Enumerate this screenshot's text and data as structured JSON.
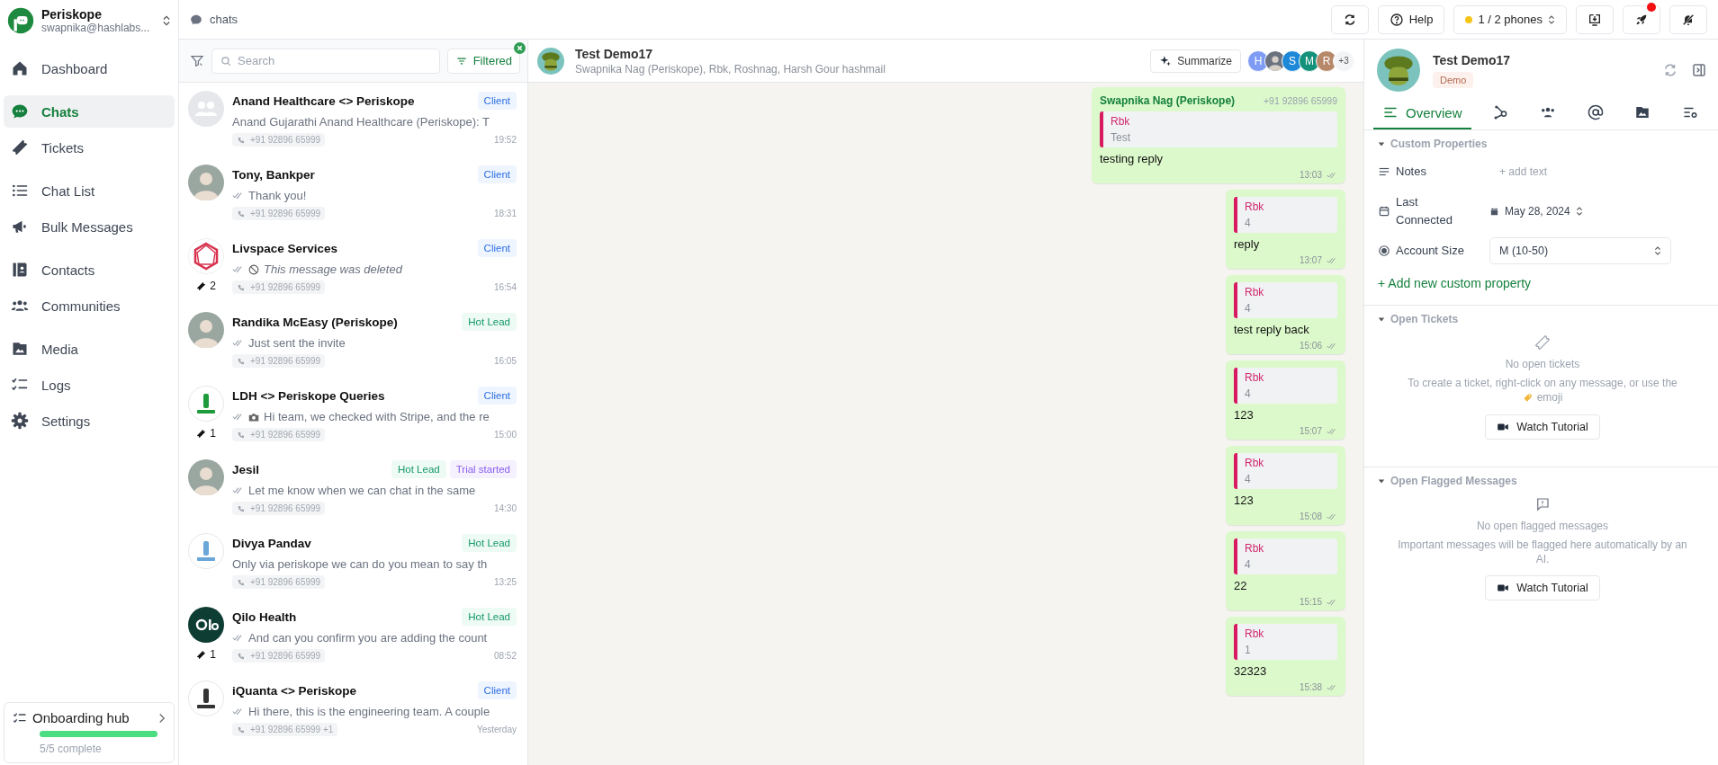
{
  "sidebar": {
    "workspace": {
      "name": "Periskope",
      "email": "swapnika@hashlabs..."
    },
    "nav_groups": [
      {
        "items": [
          {
            "label": "Dashboard",
            "selected": false
          }
        ]
      },
      {
        "items": [
          {
            "label": "Chats",
            "selected": true
          },
          {
            "label": "Tickets",
            "selected": false
          }
        ]
      },
      {
        "items": [
          {
            "label": "Chat List",
            "selected": false
          },
          {
            "label": "Bulk Messages",
            "selected": false
          }
        ]
      },
      {
        "items": [
          {
            "label": "Contacts",
            "selected": false
          },
          {
            "label": "Communities",
            "selected": false
          }
        ]
      },
      {
        "items": [
          {
            "label": "Media",
            "selected": false
          },
          {
            "label": "Logs",
            "selected": false
          },
          {
            "label": "Settings",
            "selected": false
          }
        ]
      }
    ],
    "onboarding": {
      "title": "Onboarding hub",
      "level": 1,
      "progress": "5/5 complete"
    }
  },
  "topbar": {
    "section": "chats",
    "help": "Help",
    "phones": "1 / 2 phones",
    "notification_dot": true
  },
  "chat_list": {
    "search": {
      "placeholder": "Search"
    },
    "filter": {
      "label": "Filtered",
      "active": true
    },
    "chats": [
      {
        "name": "Anand Healthcare <> Periskope",
        "avatar": {
          "kind": "group"
        },
        "tags": [
          {
            "label": "Client",
            "kind": "client"
          }
        ],
        "ticks": false,
        "preview": {
          "kind": "text",
          "text": "Anand Gujarathi Anand Healthcare (Periskope): T"
        },
        "phone": "+91 92896 65999",
        "time": "19:52"
      },
      {
        "name": "Tony, Bankper",
        "avatar": {
          "kind": "photo"
        },
        "tags": [
          {
            "label": "Client",
            "kind": "client"
          }
        ],
        "ticks": true,
        "preview": {
          "kind": "text",
          "text": "Thank you!"
        },
        "phone": "+91 92896 65999",
        "time": "18:31"
      },
      {
        "name": "Livspace Services",
        "avatar": {
          "kind": "ring",
          "color": "#d8334e"
        },
        "tags": [
          {
            "label": "Client",
            "kind": "client"
          }
        ],
        "ticks": true,
        "preview": {
          "kind": "deleted",
          "text": "This message was deleted"
        },
        "tickets": "2",
        "phone": "+91 92896 65999",
        "time": "16:54"
      },
      {
        "name": "Randika McEasy (Periskope)",
        "avatar": {
          "kind": "photo"
        },
        "tags": [
          {
            "label": "Hot Lead",
            "kind": "hot"
          }
        ],
        "ticks": true,
        "preview": {
          "kind": "text",
          "text": "Just sent the invite"
        },
        "phone": "+91 92896 65999",
        "time": "16:05"
      },
      {
        "name": "LDH <> Periskope Queries",
        "avatar": {
          "kind": "mark",
          "color": "#1f9a3a"
        },
        "tags": [
          {
            "label": "Client",
            "kind": "client"
          }
        ],
        "ticks": true,
        "preview": {
          "kind": "photo",
          "text": "Hi team, we checked with Stripe, and the re"
        },
        "tickets": "1",
        "phone": "+91 92896 65999",
        "time": "15:00"
      },
      {
        "name": "Jesil",
        "avatar": {
          "kind": "photo"
        },
        "tags": [
          {
            "label": "Hot Lead",
            "kind": "hot"
          },
          {
            "label": "Trial started",
            "kind": "trial"
          }
        ],
        "ticks": true,
        "preview": {
          "kind": "text",
          "text": "Let me know when we can chat in the same"
        },
        "phone": "+91 92896 65999",
        "time": "14:30"
      },
      {
        "name": "Divya Pandav",
        "avatar": {
          "kind": "mark",
          "color": "#6aa6d8"
        },
        "tags": [
          {
            "label": "Hot Lead",
            "kind": "hot"
          }
        ],
        "ticks": false,
        "preview": {
          "kind": "text",
          "text": "Only via periskope we can do you mean to say th"
        },
        "phone": "+91 92896 65999",
        "time": "13:25"
      },
      {
        "name": "Qilo Health",
        "avatar": {
          "kind": "solid",
          "color": "#0e3d33"
        },
        "tags": [
          {
            "label": "Hot Lead",
            "kind": "hot"
          }
        ],
        "ticks": true,
        "preview": {
          "kind": "text",
          "text": "And can you confirm you are adding the count"
        },
        "tickets": "1",
        "phone": "+91 92896 65999",
        "time": "08:52"
      },
      {
        "name": "iQuanta <> Periskope",
        "avatar": {
          "kind": "mark",
          "color": "#333333"
        },
        "tags": [
          {
            "label": "Client",
            "kind": "client"
          }
        ],
        "ticks": true,
        "preview": {
          "kind": "text",
          "text": "Hi there, this is the engineering team. A couple"
        },
        "phone": "+91 92896 65999 +1",
        "time": "Yesterday"
      }
    ]
  },
  "conversation": {
    "title": "Test Demo17",
    "participants": "Swapnika Nag (Periskope), Rbk, Roshnag, Harsh Gour hashmail",
    "summarize": "Summarize",
    "members": [
      {
        "kind": "initial",
        "initial": "H",
        "color": "#7f9cf5"
      },
      {
        "kind": "photo"
      },
      {
        "kind": "initial",
        "initial": "S",
        "color": "#1e88d8"
      },
      {
        "kind": "initial",
        "initial": "M",
        "color": "#14917a"
      },
      {
        "kind": "initial",
        "initial": "R",
        "color": "#b7876a"
      }
    ],
    "more": "+3",
    "messages": [
      {
        "sender": "Swapnika Nag (Periskope)",
        "phone": "+91 92896 65999",
        "quote": {
          "author": "Rbk",
          "text": "Test"
        },
        "text": "testing reply",
        "time": "13:03"
      },
      {
        "quote": {
          "author": "Rbk",
          "text": "4"
        },
        "text": "reply",
        "time": "13:07"
      },
      {
        "quote": {
          "author": "Rbk",
          "text": "4"
        },
        "text": "test reply back",
        "time": "15:06"
      },
      {
        "quote": {
          "author": "Rbk",
          "text": "4"
        },
        "text": "123",
        "time": "15:07"
      },
      {
        "quote": {
          "author": "Rbk",
          "text": "4"
        },
        "text": "123",
        "time": "15:08"
      },
      {
        "quote": {
          "author": "Rbk",
          "text": "4"
        },
        "text": "22",
        "time": "15:15"
      },
      {
        "quote": {
          "author": "Rbk",
          "text": "1"
        },
        "text": "32323",
        "time": "15:38"
      }
    ]
  },
  "details": {
    "name": "Test Demo17",
    "tag": "Demo",
    "tabs": [
      {
        "label": "Overview",
        "selected": true
      },
      {
        "selected": false
      },
      {
        "selected": false
      },
      {
        "selected": false
      },
      {
        "selected": false
      },
      {
        "selected": false
      }
    ],
    "custom_properties": {
      "title": "Custom Properties",
      "expanded": true,
      "properties": [
        {
          "kind": "text",
          "label": "Notes",
          "value": "+ add text"
        },
        {
          "kind": "date",
          "label": "Last Connected",
          "value": "May 28, 2024"
        },
        {
          "kind": "select",
          "label": "Account Size",
          "value": "M (10-50)"
        }
      ],
      "add": "+ Add new custom property"
    },
    "open_tickets": {
      "title": "Open Tickets",
      "expanded": true,
      "empty": "No open tickets",
      "hint": "To create a ticket, right-click on any message, or use the",
      "hint_end": "emoji",
      "button": "Watch Tutorial"
    },
    "flagged": {
      "title": "Open Flagged Messages",
      "expanded": true,
      "empty": "No open flagged messages",
      "hint": "Important messages will be flagged here automatically by an AI.",
      "button": "Watch Tutorial"
    }
  }
}
